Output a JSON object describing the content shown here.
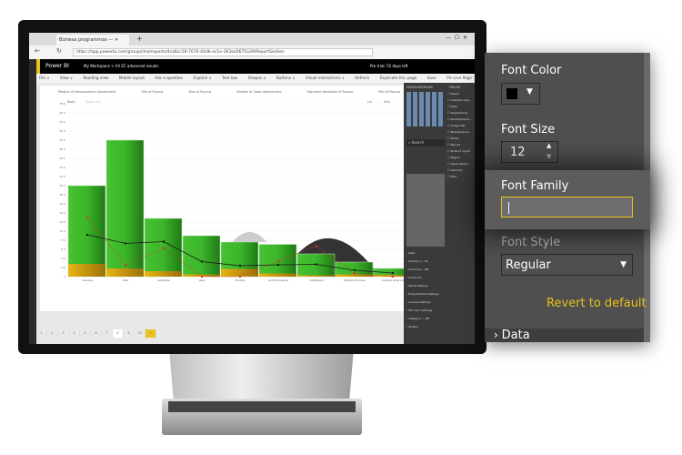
{
  "browser": {
    "tab_title": "Biznesa programmas —",
    "url": "https://app.powerbi.com/groups/me/reports/4ca6cc39-7670-44db-ac1e-363ea5675a39/ReportSection"
  },
  "powerbi": {
    "app_name": "Power BI",
    "breadcrumb": "My Workspace > All ZC advanced visuals",
    "trial": "Pro trial: 55 days left",
    "menu": [
      "File ∨",
      "View ∨",
      "Reading view",
      "Mobile layout",
      "Ask a question",
      "Explore ∨",
      "Text box",
      "Shapes ∨",
      "Buttons ∨",
      "Visual interactions ∨",
      "Refresh",
      "Duplicate this page",
      "Save",
      "Pin Live Page"
    ]
  },
  "chart_data": {
    "type": "bar",
    "categories": [
      "Canada",
      "USA",
      "Australia",
      "Asia",
      "Europe",
      "South America",
      "Caribbean",
      "Eastern Europe",
      "Central America"
    ],
    "series": [
      {
        "name": "Max of Payout",
        "values": [
          20,
          30,
          12.8,
          9,
          7.6,
          7.1,
          5,
          3.2,
          1.8
        ],
        "color": "#3cb52a"
      },
      {
        "name": "Min of Payout",
        "values": [
          2.8,
          1.8,
          1.2,
          0.5,
          1.7,
          0.7,
          0.3,
          0.5,
          0.4
        ],
        "color": "#e0ac10"
      },
      {
        "name": "Median of Sales department",
        "values": [
          13,
          2.5,
          6.3,
          0,
          0,
          3.4,
          6.7,
          0.7,
          0
        ],
        "color": "#e03030"
      },
      {
        "name": "Standard deviation of Payout",
        "values": [
          9.2,
          7.3,
          7.7,
          3.3,
          2.4,
          2.6,
          2.7,
          1.4,
          0.8
        ],
        "color": "#1a1a1a"
      }
    ],
    "legend": [
      "Median of Development department",
      "Min of Payout",
      "Max of Payout",
      "Median of Sales department",
      "Standard deviation of Payout",
      "Min of Payout"
    ],
    "yticks": [
      "0",
      "2 K",
      "4 K",
      "6 K",
      "8 K",
      "10 K",
      "12 K",
      "14 K",
      "16 K",
      "18 K",
      "20 K",
      "22 K",
      "24 K",
      "26 K",
      "28 K",
      "30 K",
      "32 K",
      "34 K",
      "36 K",
      "38 K"
    ],
    "ylim": [
      0,
      38000
    ],
    "controls": [
      "Back",
      "Zoom out",
      "Lin",
      "Info"
    ]
  },
  "viz_pane": {
    "title": "VISUALIZATIONS",
    "fields_title": "FIELDS",
    "search": "Search",
    "fields": [
      "Select",
      "Analytics dep...",
      "Date",
      "Department",
      "Development...",
      "Image URL",
      "Marketing de...",
      "Name",
      "Payout",
      "Product mgmt",
      "Region",
      "Sales depart...",
      "Seniority",
      "Title"
    ],
    "sections": [
      "Data",
      "Primary Y... On",
      "Secondar... Off",
      "X-Axis On",
      "Stack Settings",
      "Experimental Settings",
      "License Settings",
      "Fill Color Settings",
      "Category ... Off",
      "Toolbar"
    ]
  },
  "pages": [
    "1",
    "2",
    "3",
    "4",
    "5",
    "6",
    "7",
    "8",
    "9",
    "10",
    "+"
  ],
  "format_panel": {
    "font_color_label": "Font Color",
    "font_color": "#000000",
    "font_size_label": "Font Size",
    "font_size": "12",
    "font_family_label": "Font Family",
    "font_family_value": "",
    "font_style_label": "Font Style",
    "font_style": "Regular",
    "revert": "Revert to default",
    "next_section": "Data",
    "accent": "#e8c21a"
  }
}
